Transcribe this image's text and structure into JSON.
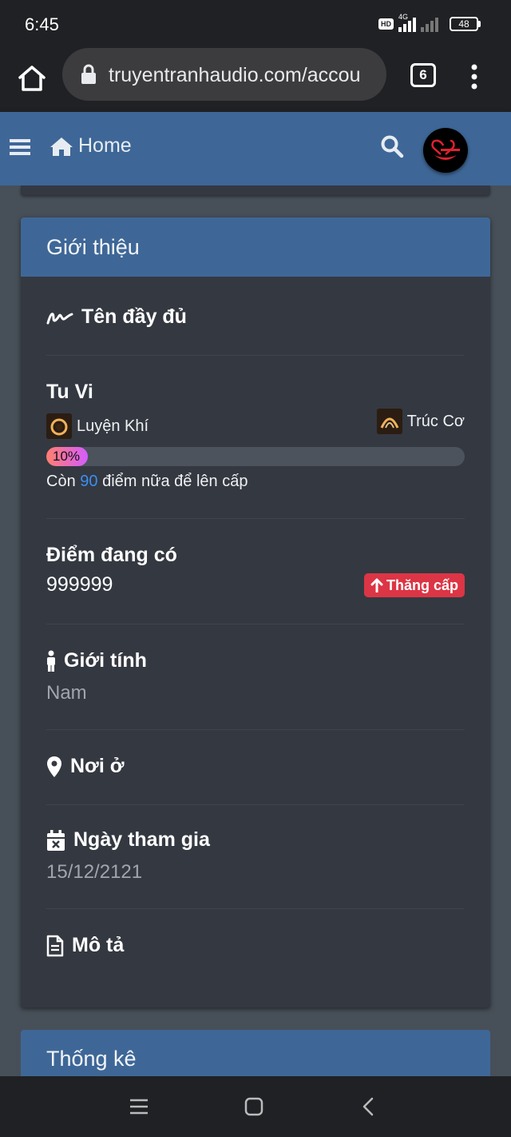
{
  "status_bar": {
    "time": "6:45",
    "hd": "HD",
    "network": "4G",
    "battery": "48"
  },
  "browser": {
    "url": "truyentranhaudio.com/accou",
    "tab_count": "6"
  },
  "header": {
    "home_label": "Home"
  },
  "about_card": {
    "title": "Giới thiệu",
    "full_name_label": "Tên đầy đủ",
    "cultivation": {
      "label": "Tu Vi",
      "current_rank": "Luyện Khí",
      "next_rank": "Trúc Cơ",
      "progress_percent": 10,
      "progress_text": "10%",
      "note_prefix": "Còn",
      "points_needed": "90",
      "note_suffix": "điểm nữa để lên cấp"
    },
    "points": {
      "label": "Điểm đang có",
      "value": "999999",
      "level_up_label": "Thăng cấp"
    },
    "gender": {
      "label": "Giới tính",
      "value": "Nam"
    },
    "location": {
      "label": "Nơi ở"
    },
    "joined": {
      "label": "Ngày tham gia",
      "value": "15/12/2121"
    },
    "description": {
      "label": "Mô tả"
    }
  },
  "stats_card": {
    "title": "Thống kê"
  },
  "colors": {
    "header_blue": "#3e6797",
    "card_bg": "#343841",
    "page_bg": "#474f58",
    "danger": "#dc3545",
    "link_blue": "#3d8ef0"
  },
  "icons": [
    "home-icon",
    "lock-icon",
    "menu-dots-icon",
    "hamburger-icon",
    "search-icon",
    "signature-icon",
    "person-icon",
    "map-marker-icon",
    "calendar-x-icon",
    "file-text-icon",
    "arrow-up-icon"
  ]
}
